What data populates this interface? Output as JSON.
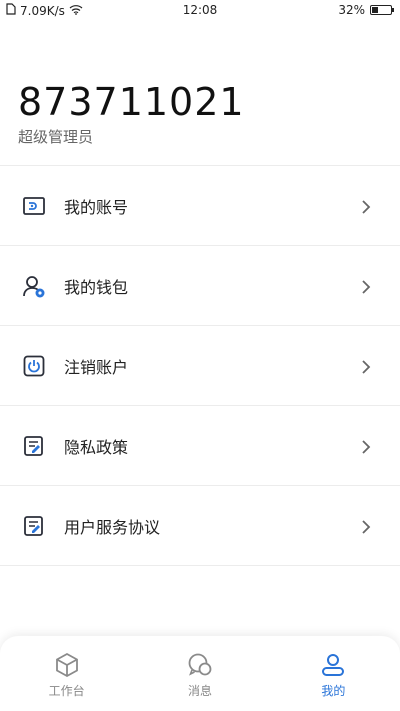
{
  "status_bar": {
    "speed": "7.09K/s",
    "time": "12:08",
    "battery_text": "32%",
    "battery_level": 0.32
  },
  "profile": {
    "account_id": "873711021",
    "role": "超级管理员"
  },
  "menu": {
    "items": [
      {
        "label": "我的账号",
        "icon": "account-card-icon"
      },
      {
        "label": "我的钱包",
        "icon": "wallet-user-icon"
      },
      {
        "label": "注销账户",
        "icon": "power-icon"
      },
      {
        "label": "隐私政策",
        "icon": "document-edit-icon"
      },
      {
        "label": "用户服务协议",
        "icon": "document-edit-icon"
      }
    ]
  },
  "bottom_nav": {
    "items": [
      {
        "label": "工作台",
        "icon": "cube-icon",
        "active": false
      },
      {
        "label": "消息",
        "icon": "chat-bubbles-icon",
        "active": false
      },
      {
        "label": "我的",
        "icon": "user-profile-icon",
        "active": true
      }
    ]
  },
  "colors": {
    "accent": "#2a74d8",
    "icon_dark": "#2b2f3a",
    "divider": "#ececec"
  }
}
